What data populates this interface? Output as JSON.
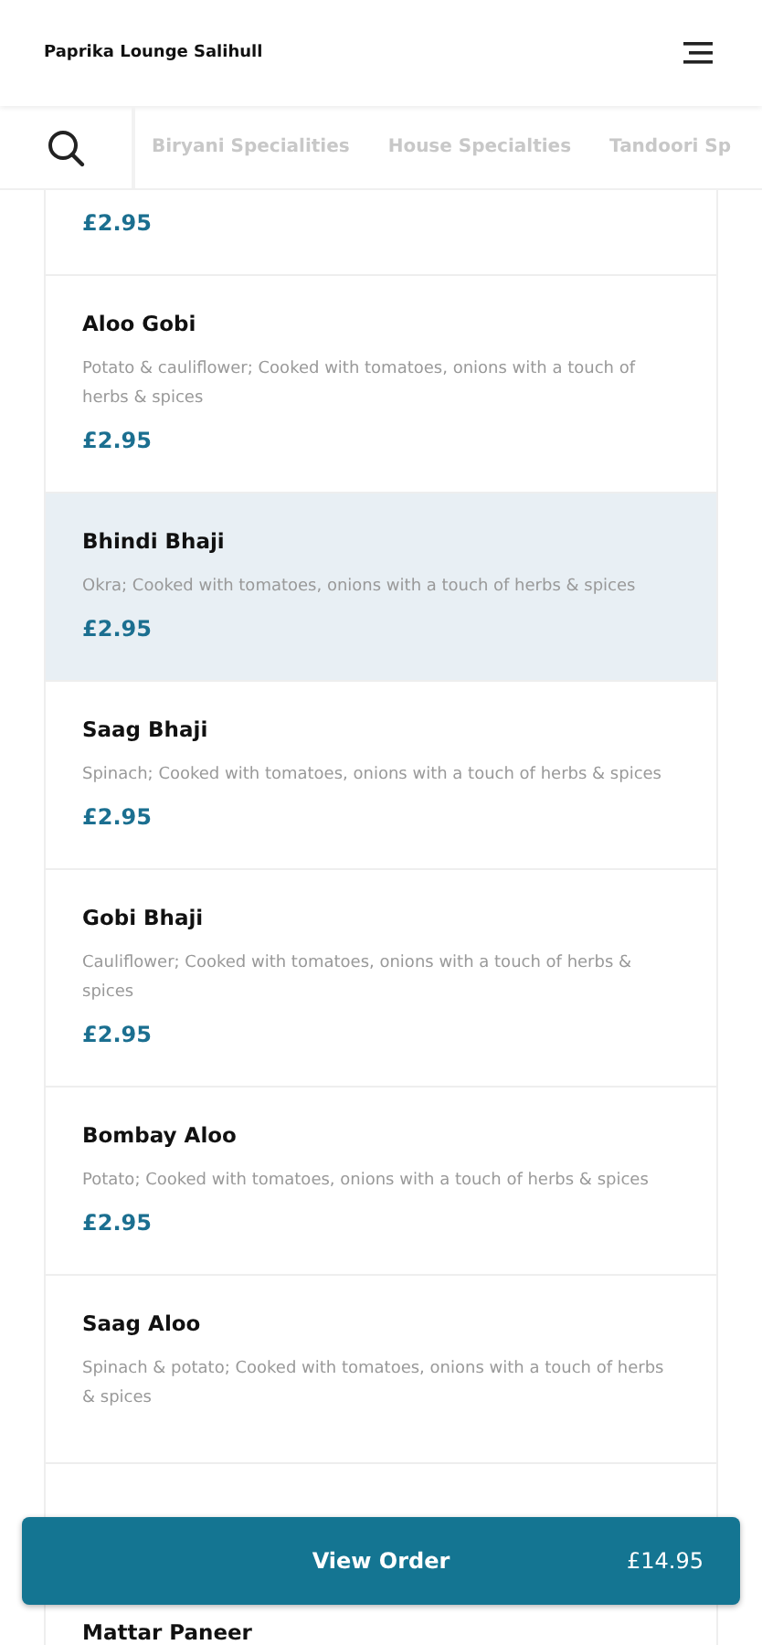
{
  "header": {
    "title": "Paprika Lounge Salihull"
  },
  "category_tabs": [
    {
      "label": "Biryani Specialities",
      "selected": false
    },
    {
      "label": "House Specialties",
      "selected": false
    },
    {
      "label": "Tandoori Sp",
      "selected": false
    }
  ],
  "menu_items": [
    {
      "kind": "partial",
      "price": "£2.95",
      "selected": false
    },
    {
      "kind": "full",
      "name": "Aloo Gobi",
      "description": "Potato & cauliflower; Cooked with tomatoes, onions with a touch of herbs & spices",
      "price": "£2.95",
      "selected": false
    },
    {
      "kind": "full",
      "name": "Bhindi Bhaji",
      "description": "Okra; Cooked with tomatoes, onions with a touch of herbs & spices",
      "price": "£2.95",
      "selected": true
    },
    {
      "kind": "full",
      "name": "Saag Bhaji",
      "description": "Spinach; Cooked with tomatoes, onions with a touch of herbs & spices",
      "price": "£2.95",
      "selected": false
    },
    {
      "kind": "full",
      "name": "Gobi Bhaji",
      "description": "Cauliflower; Cooked with tomatoes, onions with a touch of herbs & spices",
      "price": "£2.95",
      "selected": false
    },
    {
      "kind": "full",
      "name": "Bombay Aloo",
      "description": "Potato; Cooked with tomatoes, onions with a touch of herbs & spices",
      "price": "£2.95",
      "selected": false
    },
    {
      "kind": "full",
      "name": "Saag Aloo",
      "description": "Spinach & potato; Cooked with tomatoes, onions with a touch of herbs & spices",
      "selected": false
    },
    {
      "kind": "name_only",
      "name": "Mattar Paneer",
      "selected": false
    }
  ],
  "order_button": {
    "label": "View Order",
    "total": "£14.95"
  }
}
